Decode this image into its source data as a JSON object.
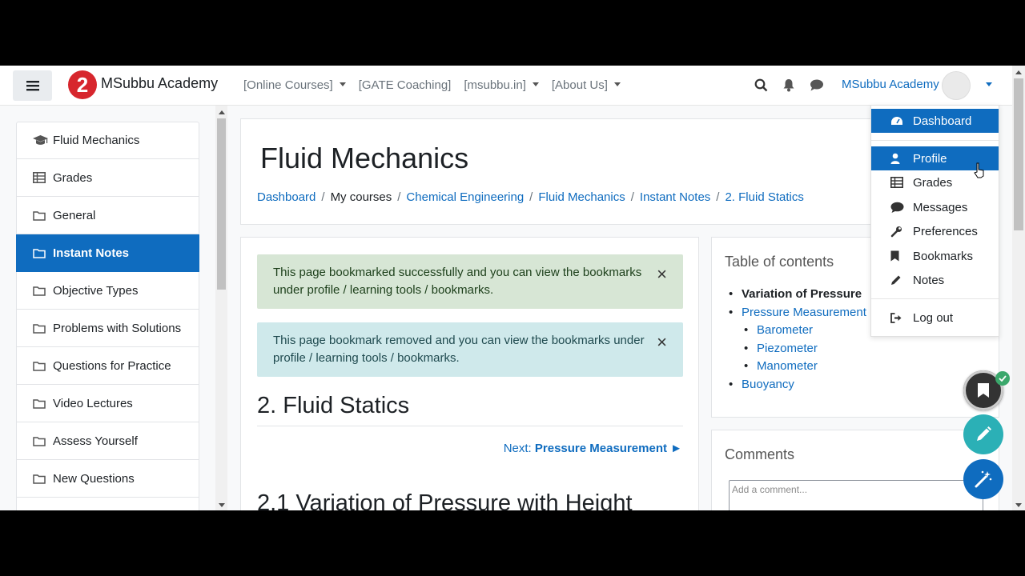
{
  "navbar": {
    "brand": "MSubbu Academy",
    "logo_text": "2",
    "links": [
      "[Online Courses]",
      "[GATE Coaching]",
      "[msubbu.in]",
      "[About Us]"
    ],
    "user_name": "MSubbu Academy"
  },
  "drawer": {
    "items": [
      {
        "label": "Fluid Mechanics",
        "icon": "graduation-cap-icon"
      },
      {
        "label": "Grades",
        "icon": "table-icon"
      },
      {
        "label": "General",
        "icon": "folder-icon"
      },
      {
        "label": "Instant Notes",
        "icon": "folder-icon"
      },
      {
        "label": "Objective Types",
        "icon": "folder-icon"
      },
      {
        "label": "Problems with Solutions",
        "icon": "folder-icon"
      },
      {
        "label": "Questions for Practice",
        "icon": "folder-icon"
      },
      {
        "label": "Video Lectures",
        "icon": "folder-icon"
      },
      {
        "label": "Assess Yourself",
        "icon": "folder-icon"
      },
      {
        "label": "New Questions",
        "icon": "folder-icon"
      }
    ],
    "active": "Instant Notes"
  },
  "header": {
    "title": "Fluid Mechanics",
    "breadcrumb": [
      "Dashboard",
      "My courses",
      "Chemical Engineering",
      "Fluid Mechanics",
      "Instant Notes",
      "2. Fluid Statics"
    ]
  },
  "alerts": {
    "success": "This page bookmarked successfully and you can view the bookmarks under profile / learning tools / bookmarks.",
    "info": "This page bookmark removed and you can view the bookmarks under profile / learning tools / bookmarks.",
    "close_glyph": "×"
  },
  "content": {
    "section_title": "2. Fluid Statics",
    "next_prefix": "Next: ",
    "next_link": "Pressure Measurement",
    "next_arrow": " ►",
    "subsection_title": "2.1 Variation of Pressure with Height"
  },
  "toc": {
    "title": "Table of contents",
    "items": [
      "Variation of Pressure",
      "Pressure Measurement",
      "Barometer",
      "Piezometer",
      "Manometer",
      "Buoyancy"
    ]
  },
  "comments": {
    "title": "Comments",
    "placeholder": "Add a comment..."
  },
  "user_menu": {
    "items": [
      "Dashboard",
      "Profile",
      "Grades",
      "Messages",
      "Preferences",
      "Bookmarks",
      "Notes",
      "Log out"
    ],
    "highlighted": [
      "Dashboard",
      "Profile"
    ]
  },
  "colors": {
    "primary": "#0f6cbf",
    "success_bg": "#d7e6d5",
    "info_bg": "#cfe9eb",
    "fab_teal": "#2bb0b6"
  }
}
